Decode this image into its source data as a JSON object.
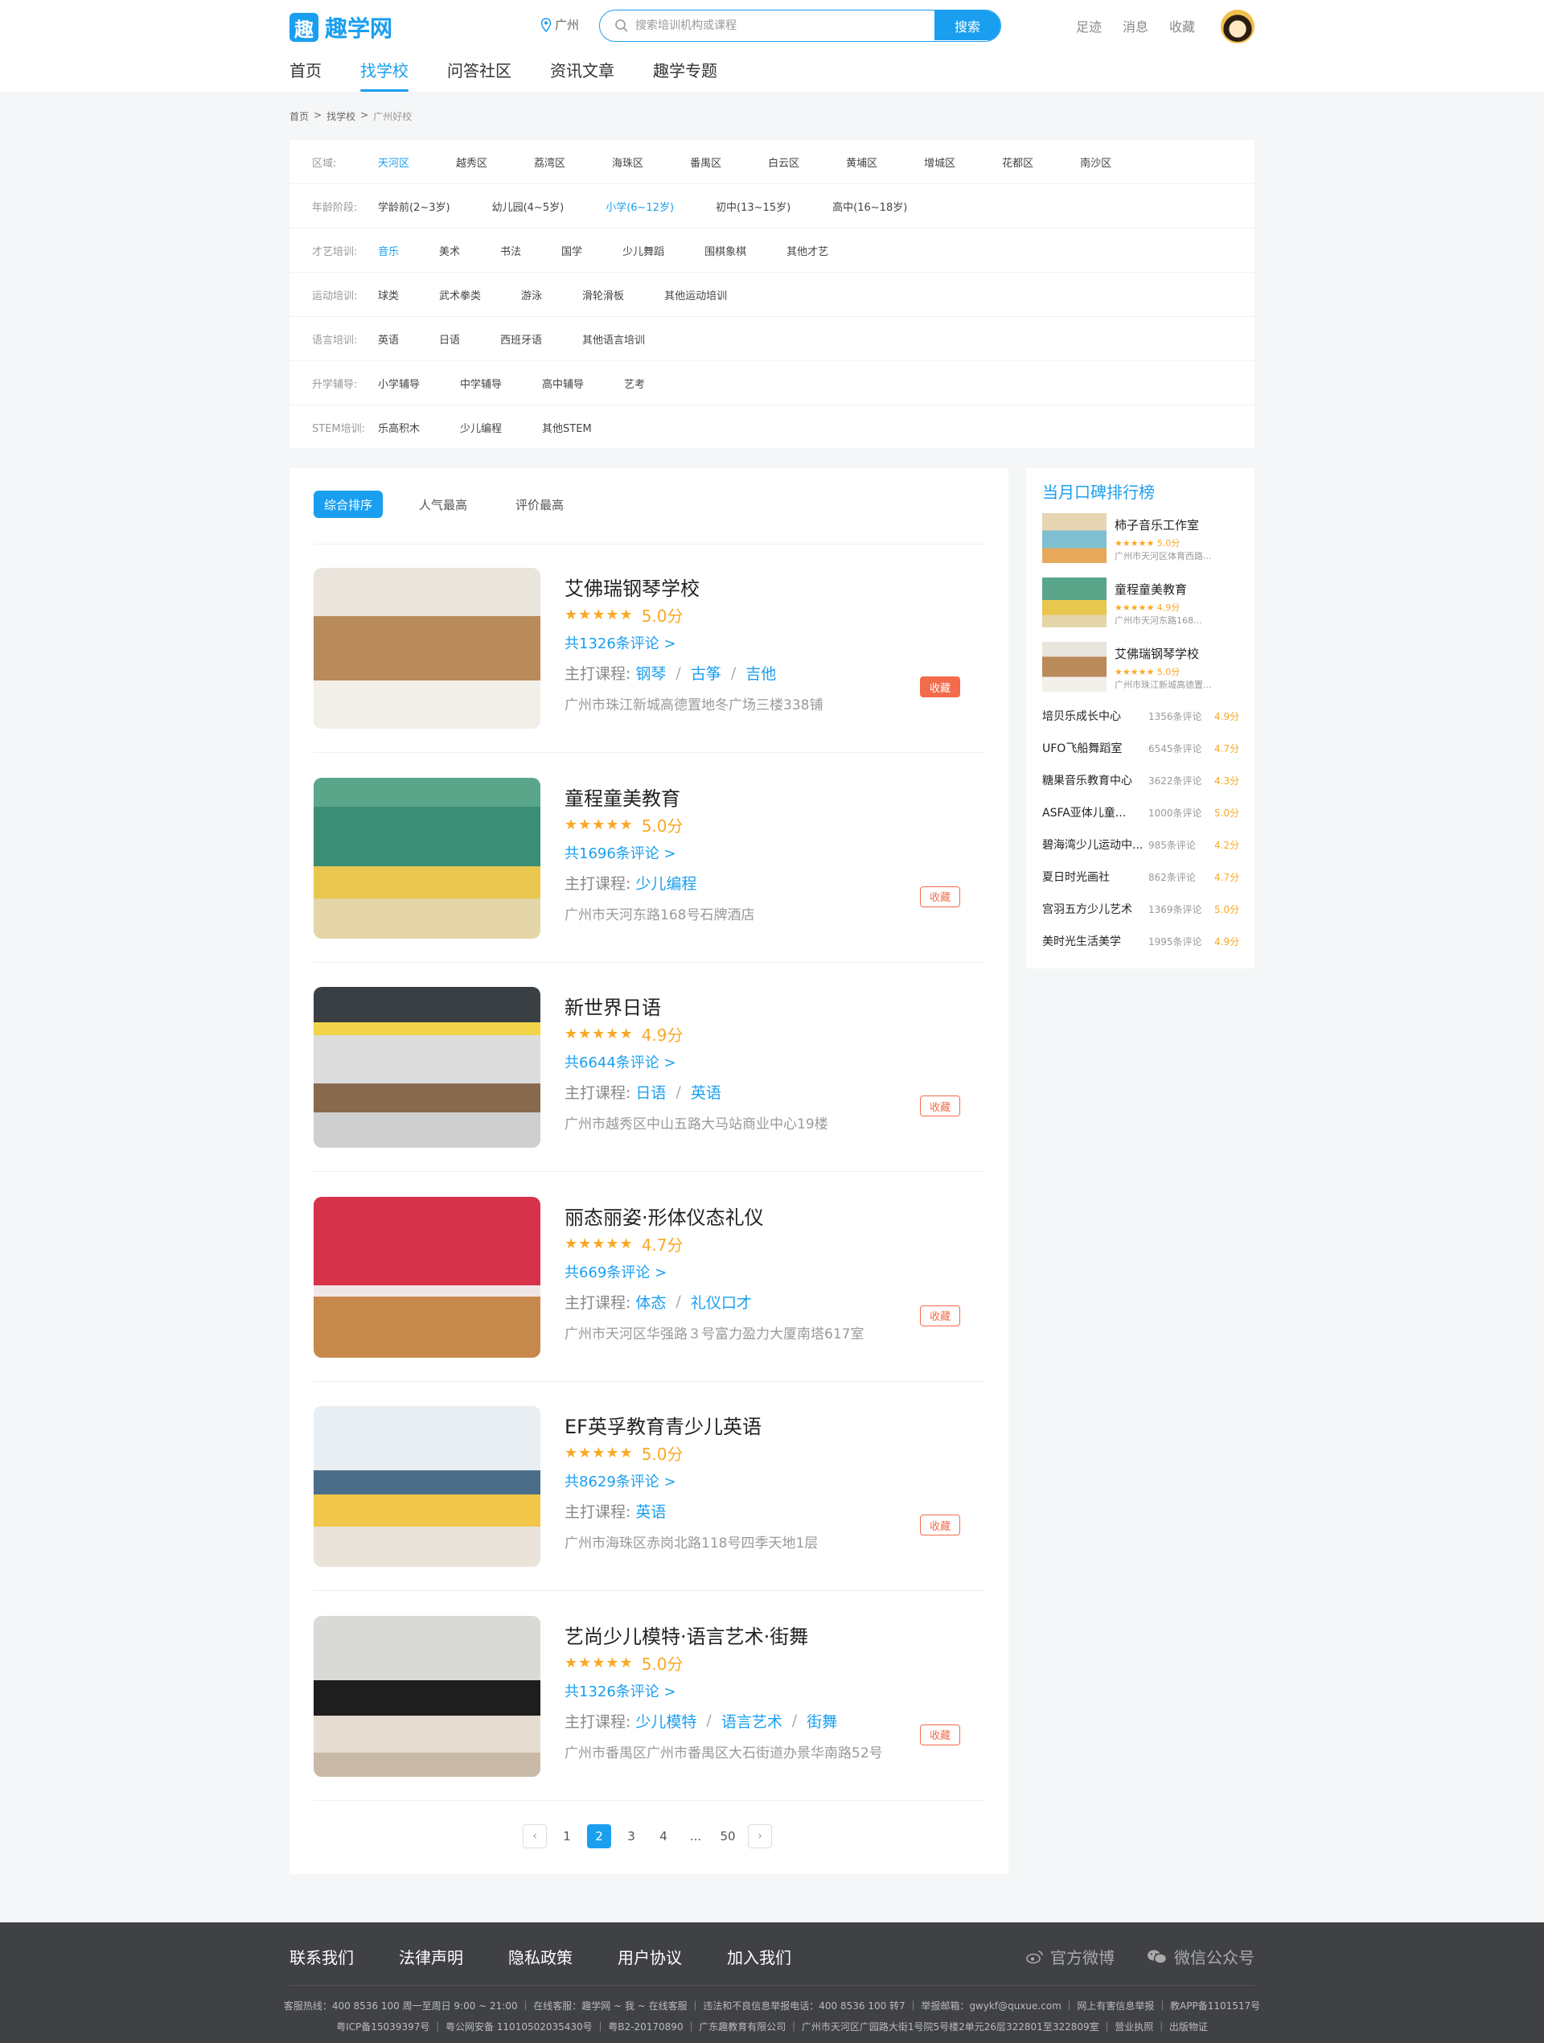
{
  "header": {
    "logo_char": "趣",
    "logo_text": "趣学网",
    "city": "广州",
    "search_placeholder": "搜索培训机构或课程",
    "search_button": "搜索",
    "links": [
      "足迹",
      "消息",
      "收藏"
    ],
    "nav": [
      "首页",
      "找学校",
      "问答社区",
      "资讯文章",
      "趣学专题"
    ],
    "nav_active": 1
  },
  "breadcrumb": [
    "首页",
    ">",
    "找学校",
    ">",
    "广州好校"
  ],
  "filters": [
    {
      "label": "区域:",
      "options": [
        "天河区",
        "越秀区",
        "荔湾区",
        "海珠区",
        "番禺区",
        "白云区",
        "黄埔区",
        "增城区",
        "花都区",
        "南沙区"
      ],
      "active": 0
    },
    {
      "label": "年龄阶段:",
      "options": [
        "学龄前(2~3岁)",
        "幼儿园(4~5岁)",
        "小学(6~12岁)",
        "初中(13~15岁)",
        "高中(16~18岁)"
      ],
      "active": 2
    },
    {
      "label": "才艺培训:",
      "options": [
        "音乐",
        "美术",
        "书法",
        "国学",
        "少儿舞蹈",
        "围棋象棋",
        "其他才艺"
      ],
      "active": 0
    },
    {
      "label": "运动培训:",
      "options": [
        "球类",
        "武术拳类",
        "游泳",
        "滑轮滑板",
        "其他运动培训"
      ],
      "active": -1
    },
    {
      "label": "语言培训:",
      "options": [
        "英语",
        "日语",
        "西班牙语",
        "其他语言培训"
      ],
      "active": -1
    },
    {
      "label": "升学辅导:",
      "options": [
        "小学辅导",
        "中学辅导",
        "高中辅导",
        "艺考"
      ],
      "active": -1
    },
    {
      "label": "STEM培训:",
      "options": [
        "乐高积木",
        "少儿编程",
        "其他STEM"
      ],
      "active": -1
    }
  ],
  "sorts": [
    "综合排序",
    "人气最高",
    "评价最高"
  ],
  "schools": [
    {
      "name": "艾佛瑞钢琴学校",
      "stars": "★★★★★",
      "score": "5.0分",
      "reviews": "共1326条评论 >",
      "course_label": "主打课程:",
      "courses": [
        "钢琴",
        "古筝",
        "吉他"
      ],
      "address": "广州市珠江新城高德置地冬广场三楼338铺",
      "fav": "收藏",
      "fav_active": true,
      "theme": "piano"
    },
    {
      "name": "童程童美教育",
      "stars": "★★★★★",
      "score": "5.0分",
      "reviews": "共1696条评论 >",
      "course_label": "主打课程:",
      "courses": [
        "少儿编程"
      ],
      "address": "广州市天河东路168号石牌酒店",
      "fav": "收藏",
      "fav_active": false,
      "theme": "green"
    },
    {
      "name": "新世界日语",
      "stars": "★★★★★",
      "score": "4.9分",
      "reviews": "共6644条评论 >",
      "course_label": "主打课程:",
      "courses": [
        "日语",
        "英语"
      ],
      "address": "广州市越秀区中山五路大马站商业中心19楼",
      "fav": "收藏",
      "fav_active": false,
      "theme": "class"
    },
    {
      "name": "丽态丽姿·形体仪态礼仪",
      "stars": "★★★★★",
      "score": "4.7分",
      "reviews": "共669条评论 >",
      "course_label": "主打课程:",
      "courses": [
        "体态",
        "礼仪口才"
      ],
      "address": "广州市天河区华强路３号富力盈力大厦南塔617室",
      "fav": "收藏",
      "fav_active": false,
      "theme": "red"
    },
    {
      "name": "EF英孚教育青少儿英语",
      "stars": "★★★★★",
      "score": "5.0分",
      "reviews": "共8629条评论 >",
      "course_label": "主打课程:",
      "courses": [
        "英语"
      ],
      "address": "广州市海珠区赤岗北路118号四季天地1层",
      "fav": "收藏",
      "fav_active": false,
      "theme": "ef"
    },
    {
      "name": "艺尚少儿模特·语言艺术·街舞",
      "stars": "★★★★★",
      "score": "5.0分",
      "reviews": "共1326条评论 >",
      "course_label": "主打课程:",
      "courses": [
        "少儿模特",
        "语言艺术",
        "街舞"
      ],
      "address": "广州市番禺区广州市番禺区大石街道办景华南路52号",
      "fav": "收藏",
      "fav_active": false,
      "theme": "ballet"
    }
  ],
  "pagination": {
    "prev": "‹",
    "pages": [
      "1",
      "2",
      "3",
      "4",
      "...",
      "50"
    ],
    "active": 1,
    "next": "›"
  },
  "sidebar": {
    "title": "当月口碑排行榜",
    "top": [
      {
        "name": "柿子音乐工作室",
        "stars": "★★★★★",
        "score": "5.0分",
        "address": "广州市天河区体育西路..."
      },
      {
        "name": "童程童美教育",
        "stars": "★★★★★",
        "score": "4.9分",
        "address": "广州市天河东路168..."
      },
      {
        "name": "艾佛瑞钢琴学校",
        "stars": "★★★★★",
        "score": "5.0分",
        "address": "广州市珠江新城高德置..."
      }
    ],
    "ranks": [
      {
        "name": "培贝乐成长中心",
        "reviews": "1356条评论",
        "score": "4.9分"
      },
      {
        "name": "UFO飞船舞蹈室",
        "reviews": "6545条评论",
        "score": "4.7分"
      },
      {
        "name": "糖果音乐教育中心",
        "reviews": "3622条评论",
        "score": "4.3分"
      },
      {
        "name": "ASFA亚体儿童...",
        "reviews": "1000条评论",
        "score": "5.0分"
      },
      {
        "name": "碧海湾少儿运动中...",
        "reviews": "985条评论",
        "score": "4.2分"
      },
      {
        "name": "夏日时光画社",
        "reviews": "862条评论",
        "score": "4.7分"
      },
      {
        "name": "宫羽五方少儿艺术",
        "reviews": "1369条评论",
        "score": "5.0分"
      },
      {
        "name": "美时光生活美学",
        "reviews": "1995条评论",
        "score": "4.9分"
      }
    ]
  },
  "footer": {
    "links": [
      "联系我们",
      "法律声明",
      "隐私政策",
      "用户协议",
      "加入我们"
    ],
    "weibo": "官方微博",
    "wechat": "微信公众号",
    "line1": "客服热线：400 8536 100 周一至周日 9:00 ~ 21:00 ｜ 在线客服：趣学网 ~ 我 ~ 在线客服 ｜ 违法和不良信息举报电话：400 8536 100 转7 ｜ 举报邮箱：gwykf@quxue.com ｜ 网上有害信息举报 ｜ 教APP备1101517号",
    "line2": "粤ICP备15039397号 ｜ 粤公网安备 11010502035430号 ｜ 粤B2-20170890 ｜ 广东趣教育有限公司 ｜ 广州市天河区广园路大街1号院5号楼2单元26层322801至322809室 ｜ 营业执照 ｜ 出版物证"
  }
}
